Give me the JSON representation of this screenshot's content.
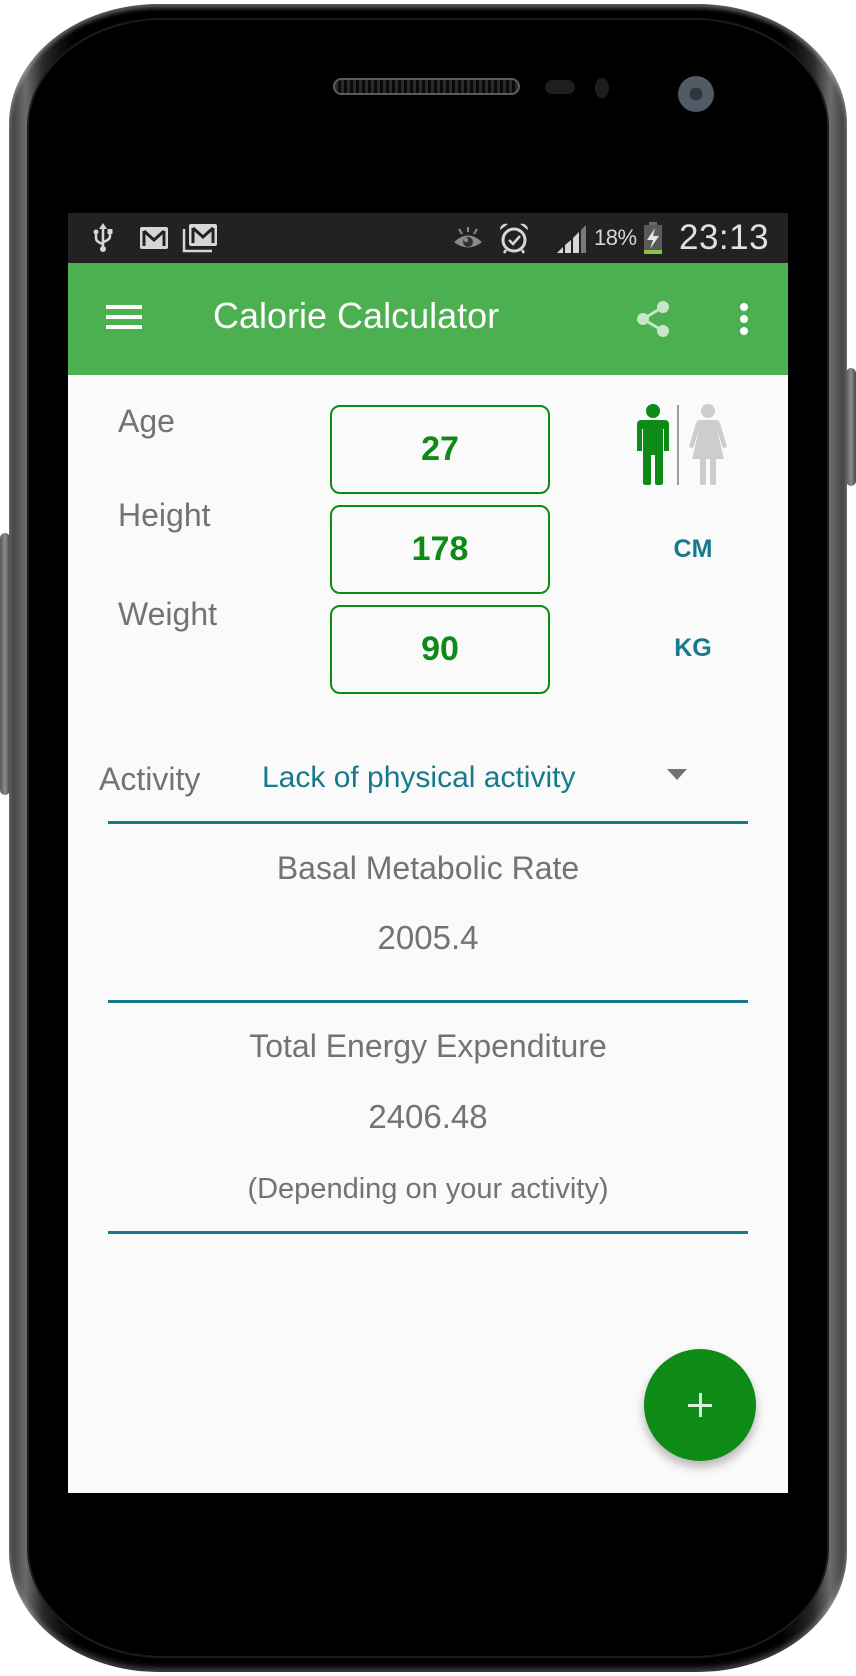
{
  "status_bar": {
    "icons_left": [
      "usb-icon",
      "gmail-icon",
      "gmail-multiple-icon"
    ],
    "icons_right": [
      "eye-icon",
      "alarm-icon",
      "signal-icon"
    ],
    "battery_percent": "18%",
    "battery_state": "charging",
    "time": "23:13"
  },
  "app_bar": {
    "title": "Calorie Calculator",
    "menu_icon": "hamburger-menu-icon",
    "actions": [
      "share-icon",
      "overflow-menu-icon"
    ],
    "color": "#4caf50"
  },
  "form": {
    "age": {
      "label": "Age",
      "value": "27"
    },
    "height": {
      "label": "Height",
      "value": "178",
      "unit": "CM"
    },
    "weight": {
      "label": "Weight",
      "value": "90",
      "unit": "KG"
    },
    "gender": {
      "selected": "male",
      "options": [
        "male",
        "female"
      ]
    },
    "activity": {
      "label": "Activity",
      "value": "Lack of physical activity"
    }
  },
  "results": {
    "bmr": {
      "title": "Basal Metabolic Rate",
      "value": "2005.4"
    },
    "tee": {
      "title": "Total Energy Expenditure",
      "value": "2406.48",
      "note": "(Depending on your activity)"
    }
  },
  "fab": {
    "icon": "plus-icon"
  },
  "colors": {
    "accent_green": "#0e8a16",
    "teal": "#17798c",
    "text_gray": "#737373",
    "inactive_gray": "#c8c8c8"
  }
}
